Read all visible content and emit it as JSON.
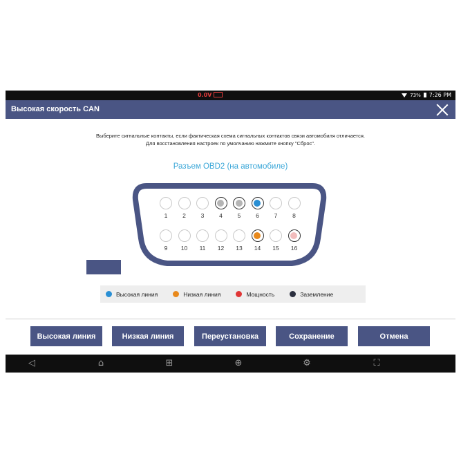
{
  "status_bar": {
    "voltage": "0.0V",
    "battery": "73%",
    "time": "7:26 PM"
  },
  "header": {
    "title": "Высокая скорость CAN"
  },
  "instructions": {
    "line1": "Выберите сигнальные контакты, если фактическая схема сигнальных контактов связи автомобиля отличается.",
    "line2": "Для восстановления настроек по умолчанию нажмите кнопку \"Сброс\"."
  },
  "connector": {
    "title": "Разъем OBD2 (на автомобиле)",
    "pins_top": [
      {
        "num": "1",
        "state": "empty"
      },
      {
        "num": "2",
        "state": "empty"
      },
      {
        "num": "3",
        "state": "empty"
      },
      {
        "num": "4",
        "state": "grey"
      },
      {
        "num": "5",
        "state": "grey"
      },
      {
        "num": "6",
        "state": "blue"
      },
      {
        "num": "7",
        "state": "empty"
      },
      {
        "num": "8",
        "state": "empty"
      }
    ],
    "pins_bottom": [
      {
        "num": "9",
        "state": "empty"
      },
      {
        "num": "10",
        "state": "empty"
      },
      {
        "num": "11",
        "state": "empty"
      },
      {
        "num": "12",
        "state": "empty"
      },
      {
        "num": "13",
        "state": "empty"
      },
      {
        "num": "14",
        "state": "orange"
      },
      {
        "num": "15",
        "state": "empty"
      },
      {
        "num": "16",
        "state": "pink"
      }
    ]
  },
  "legend": [
    {
      "label": "Высокая линия",
      "color": "#2a8fd4"
    },
    {
      "label": "Низкая линия",
      "color": "#e8891c"
    },
    {
      "label": "Мощность",
      "color": "#e03636"
    },
    {
      "label": "Заземление",
      "color": "#2b2f3f"
    }
  ],
  "colors": {
    "accent": "#4a5584",
    "grey": "#b5b5b5",
    "blue": "#2a8fd4",
    "orange": "#e8891c",
    "pink": "#f2bcbc"
  },
  "buttons": {
    "high_line": "Высокая линия",
    "low_line": "Низкая линия",
    "reset": "Переустановка",
    "save": "Сохранение",
    "cancel": "Отмена"
  },
  "nav_icons": [
    "back-icon",
    "home-icon",
    "recent-apps-icon",
    "browser-icon",
    "settings-icon",
    "screenshot-icon"
  ]
}
